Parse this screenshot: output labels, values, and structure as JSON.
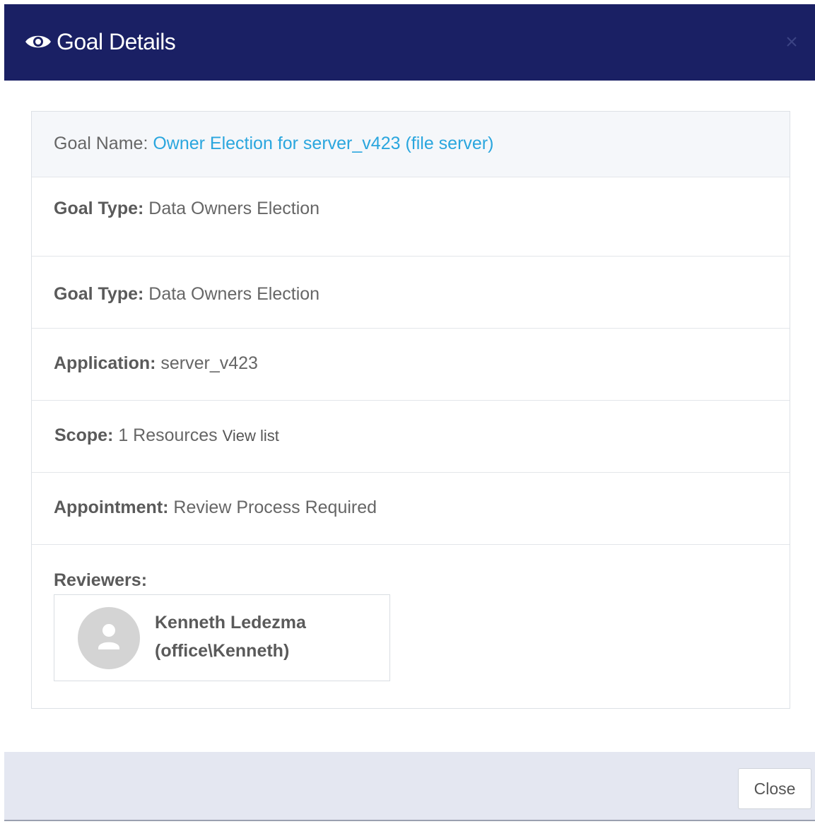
{
  "header": {
    "title": "Goal Details",
    "icons": {
      "title_icon": "eye-icon",
      "close_icon": "close-x-icon"
    },
    "background_color": "#1a2064"
  },
  "details": {
    "goal_name": {
      "label": "Goal Name:",
      "value": "Owner Election for server_v423 (file server)"
    },
    "goal_type_1": {
      "label": "Goal Type:",
      "value": "Data Owners Election"
    },
    "goal_type_2": {
      "label": "Goal Type:",
      "value": "Data Owners Election"
    },
    "application": {
      "label": "Application:",
      "value": "server_v423"
    },
    "scope": {
      "label": "Scope:",
      "value": "1 Resources",
      "link": "View list"
    },
    "appointment": {
      "label": "Appointment:",
      "value": "Review Process Required"
    },
    "reviewers": {
      "label": "Reviewers:",
      "items": [
        {
          "name": "Kenneth Ledezma",
          "account": "(office\\Kenneth)",
          "avatar_icon": "user-icon"
        }
      ]
    }
  },
  "footer": {
    "close_label": "Close"
  },
  "colors": {
    "link": "#2aa6de",
    "footer_bg": "#e4e7f1"
  }
}
